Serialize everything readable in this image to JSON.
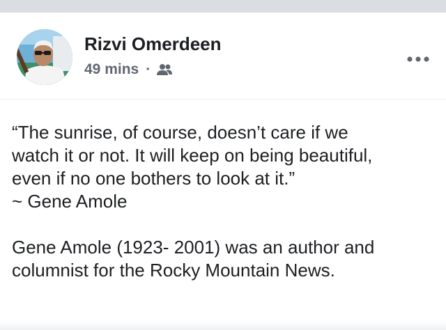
{
  "post": {
    "author": "Rizvi Omerdeen",
    "timestamp": "49 mins",
    "separator": "·",
    "audience_icon": "friends-icon",
    "more_icon": "ellipsis-icon",
    "text_lines": [
      "“The sunrise, of course, doesn’t care if we",
      "watch it or not. It will keep on being beautiful,",
      "even if no one bothers to look at it.”",
      "~ Gene Amole",
      "",
      "Gene Amole (1923- 2001) was an author and",
      "columnist for the Rocky Mountain News."
    ]
  },
  "colors": {
    "background": "#ffffff",
    "top_strip": "#dadde1",
    "text_primary": "#1c1e21",
    "text_secondary": "#606770"
  }
}
